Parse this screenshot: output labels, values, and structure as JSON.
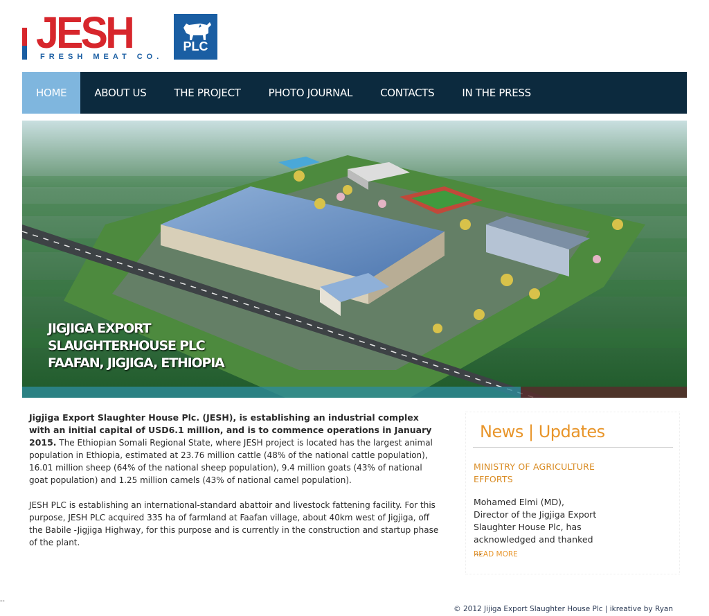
{
  "logo": {
    "word": "JESH",
    "tagline": "FRESH MEAT CO.",
    "plc": "PLC",
    "colors": {
      "red": "#d7262c",
      "blue": "#1a5ea3"
    }
  },
  "nav": {
    "items": [
      {
        "label": "HOME",
        "active": true
      },
      {
        "label": "ABOUT US"
      },
      {
        "label": "THE PROJECT"
      },
      {
        "label": "PHOTO JOURNAL"
      },
      {
        "label": "CONTACTS"
      },
      {
        "label": "IN THE PRESS"
      }
    ],
    "colors": {
      "bar": "#0c2a3e",
      "active": "#7fb6de"
    }
  },
  "hero": {
    "caption_line1": "JIGJIGA EXPORT",
    "caption_line2": "SLAUGHTERHOUSE PLC",
    "caption_line3": "FAAFAN, JIGJIGA, ETHIOPIA"
  },
  "main": {
    "lead": "Jigjiga Export Slaughter House Plc. (JESH), is establishing an industrial complex with an initial capital of USD6.1 million, and is to commence operations in January 2015.",
    "para1_rest": " The Ethiopian Somali Regional State, where JESH project is located has the largest animal population in Ethiopia, estimated at 23.76 million cattle (48% of the national cattle population), 16.01 million sheep (64% of the national sheep population), 9.4 million goats (43% of national goat population) and 1.25 million camels (43% of national camel population).",
    "para2": "JESH PLC is establishing an international-standard abattoir and livestock fattening facility. For this purpose, JESH PLC acquired 335 ha of farmland at Faafan village, about 40km west of Jigjiga, off the Babile -Jigjiga Highway, for this purpose and is currently in the construction and startup phase of the plant."
  },
  "news": {
    "title": "News | Updates",
    "headline": "MINISTRY OF AGRICULTURE EFFORTS",
    "body": "Mohamed Elmi (MD), Director of the Jigjiga Export Slaughter House Plc, has acknowledged and thanked ...",
    "more": "READ MORE",
    "accent": "#e8952a"
  },
  "footer": {
    "text": "© 2012 Jijiga Export Slaughter House Plc | ikreative by Ryan"
  },
  "misc": {
    "dash": "--"
  }
}
